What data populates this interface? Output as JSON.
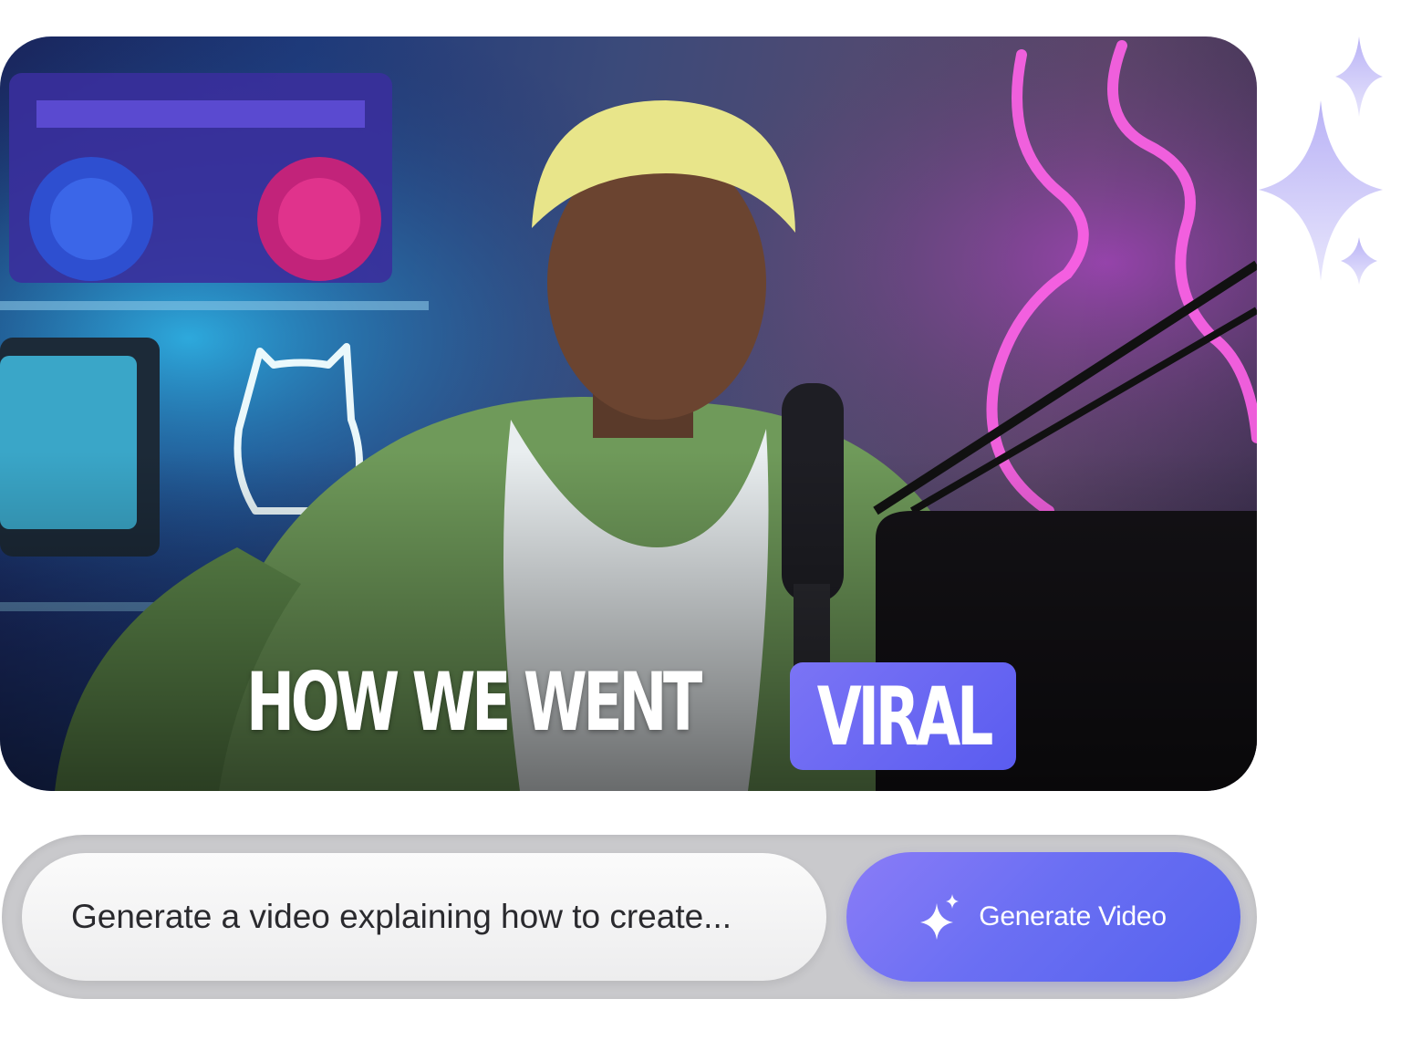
{
  "video_preview": {
    "caption_text": "HOW WE WENT",
    "caption_highlight": "VIRAL",
    "highlight_color": "#6366f1"
  },
  "prompt": {
    "placeholder": "Generate a video explaining how to create...",
    "button_label": "Generate Video",
    "button_icon": "sparkle-icon",
    "accent_color": "#5b63ef"
  },
  "decoration": {
    "icon": "sparkles-icon",
    "color": "#c9c3f7"
  }
}
